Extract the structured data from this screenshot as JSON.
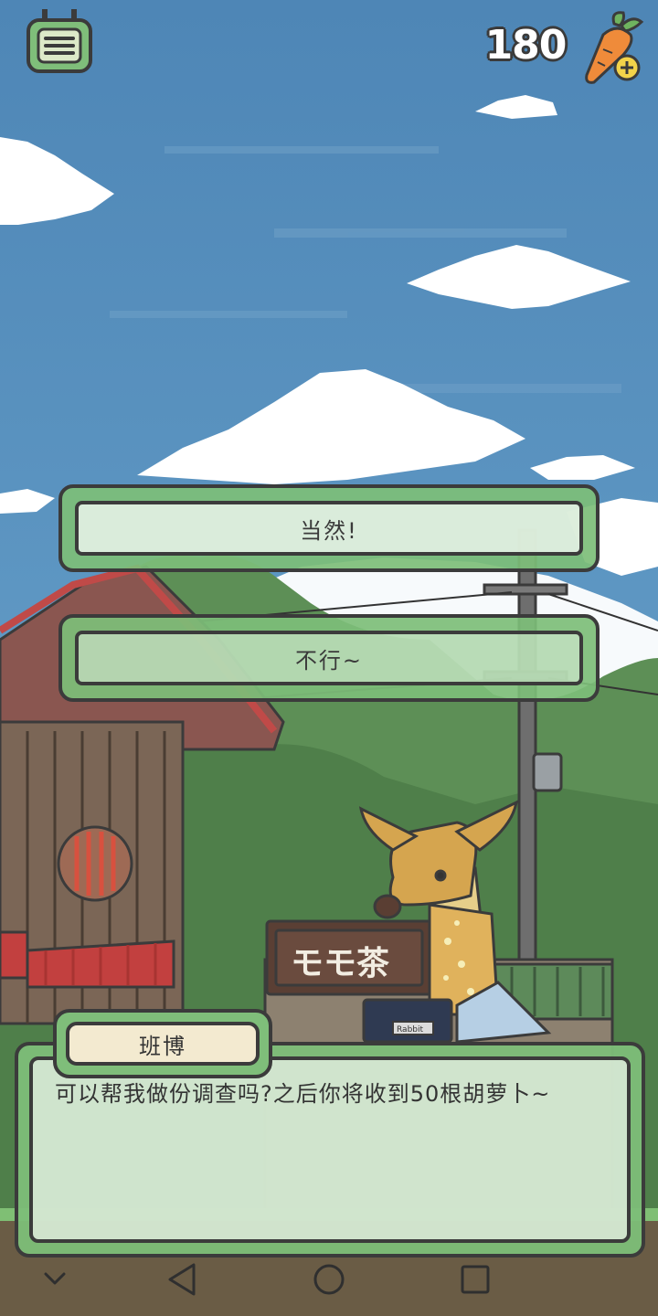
{
  "hud": {
    "carrot_count": "180",
    "menu_icon": "menu-icon",
    "carrot_icon": "carrot-add-icon"
  },
  "choices": [
    {
      "label": "当然!"
    },
    {
      "label": "不行~"
    }
  ],
  "dialog": {
    "speaker": "班博",
    "text": "可以帮我做份调查吗?之后你将收到50根胡萝卜~"
  },
  "scene": {
    "shop_sign": "モモ茶",
    "book_label": "Rabbit"
  },
  "navbar": {
    "icons": [
      "chevron-down-icon",
      "back-icon",
      "home-icon",
      "recents-icon"
    ]
  },
  "colors": {
    "panel_green": "#7dbe78",
    "outline": "#3b3b3b",
    "sky": "#4a82b2"
  }
}
